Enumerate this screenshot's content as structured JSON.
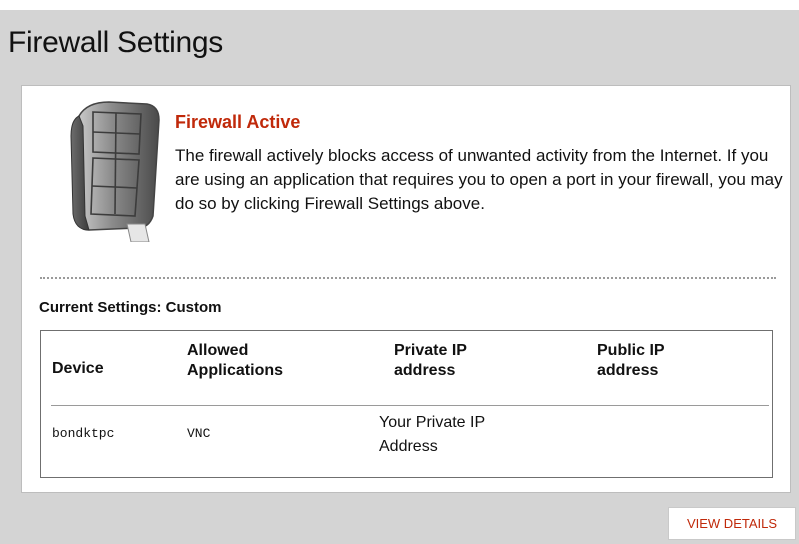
{
  "header": {
    "title": "Firewall Settings"
  },
  "status": {
    "title": "Firewall Active",
    "description": "The firewall actively blocks access of unwanted activity from the Internet. If you are using an application that requires you to open a port in your firewall, you may do so by clicking Firewall Settings above."
  },
  "settings": {
    "current_label": "Current Settings: Custom"
  },
  "table": {
    "headers": {
      "device": "Device",
      "allowed_line1": "Allowed",
      "allowed_line2": "Applications",
      "private_line1": "Private IP",
      "private_line2": "address",
      "public_line1": "Public IP",
      "public_line2": "address"
    },
    "rows": [
      {
        "device": "bondktpc",
        "app": "VNC",
        "private_line1": "Your Private IP",
        "private_line2": "Address",
        "public": ""
      }
    ]
  },
  "actions": {
    "view_details": "VIEW DETAILS"
  },
  "colors": {
    "accent": "#c0290a",
    "frame": "#d4d4d4"
  }
}
